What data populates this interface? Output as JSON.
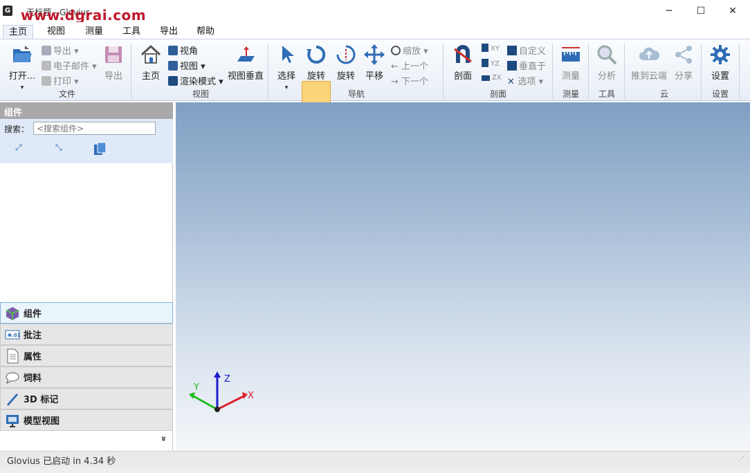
{
  "titlebar": {
    "icon": "G",
    "title": "- 无标题 - Glovius",
    "watermark": "www.dgrai.com",
    "minimize": "─",
    "maximize": "☐",
    "close": "✕"
  },
  "tabs": [
    {
      "label": "主页",
      "active": true
    },
    {
      "label": "视图"
    },
    {
      "label": "测量"
    },
    {
      "label": "工具"
    },
    {
      "label": "导出"
    },
    {
      "label": "帮助"
    }
  ],
  "ribbon": {
    "file": {
      "label": "文件",
      "open": "打开...",
      "export": "导出",
      "email": "电子邮件",
      "print": "打印",
      "export2": "导出"
    },
    "view": {
      "label": "视图",
      "home": "主页",
      "view_angle": "视角",
      "view": "视图",
      "render": "渲染模式",
      "view_normal": "视图垂直"
    },
    "nav": {
      "label": "导航",
      "select": "选择",
      "rotate_active": "旋转",
      "rotate": "旋转",
      "pan": "平移",
      "zoom": "缩放",
      "prev": "上一个",
      "next": "下一个"
    },
    "section": {
      "label": "剖面",
      "section": "剖面",
      "xy": "XY",
      "yz": "YZ",
      "zx": "ZX",
      "custom": "自定义",
      "normal": "垂直于",
      "options": "选项"
    },
    "measure": {
      "label": "测量",
      "measure": "测量"
    },
    "tools": {
      "label": "工具",
      "analyze": "分析"
    },
    "cloud": {
      "label": "云",
      "push": "推到云端",
      "share": "分享"
    },
    "settings": {
      "label": "设置",
      "settings": "设置"
    }
  },
  "leftpanel": {
    "header": "组件",
    "search_label": "搜索：",
    "search_placeholder": "<搜索组件>",
    "nav": [
      {
        "label": "组件",
        "icon": "cube-icon",
        "selected": true
      },
      {
        "label": "批注",
        "icon": "annotation-icon"
      },
      {
        "label": "属性",
        "icon": "document-icon"
      },
      {
        "label": "饲料",
        "icon": "comment-icon"
      },
      {
        "label": "3D 标记",
        "icon": "pen-icon"
      },
      {
        "label": "模型视图",
        "icon": "monitor-icon"
      }
    ],
    "more": "»"
  },
  "axes": {
    "x": "X",
    "y": "Y",
    "z": "Z"
  },
  "status": "Glovius  已启动 in 4.34 秒",
  "colors": {
    "accent": "#2f6db5",
    "active": "#fcd47a",
    "x_axis": "#e0202a",
    "y_axis": "#22bb22",
    "z_axis": "#1a1acc"
  }
}
